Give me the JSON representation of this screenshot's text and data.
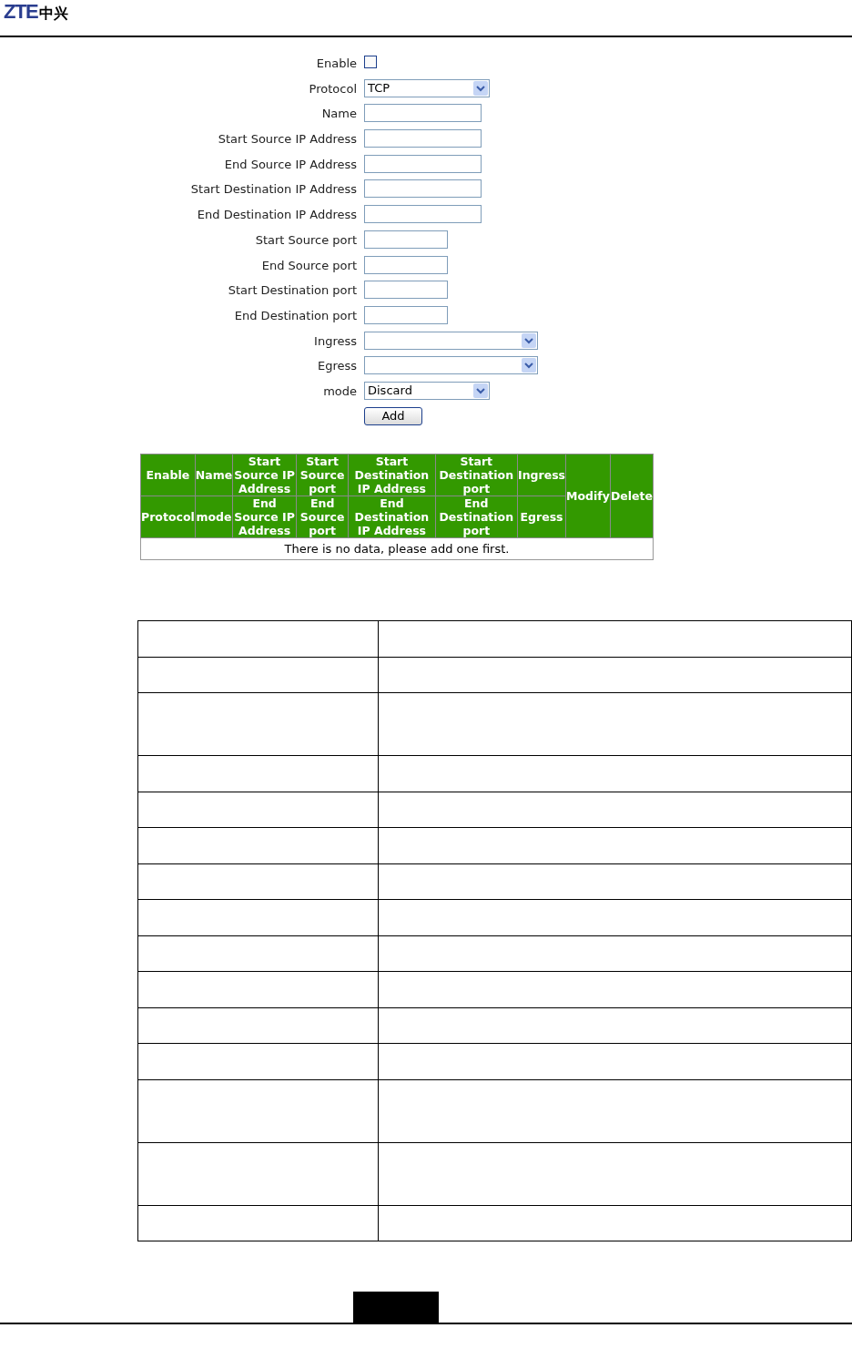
{
  "logo": {
    "latin": "ZTE",
    "cjk": "中兴"
  },
  "form": {
    "fields": [
      {
        "label": "Enable",
        "kind": "checkbox",
        "checked": false
      },
      {
        "label": "Protocol",
        "kind": "select",
        "value": "TCP"
      },
      {
        "label": "Name",
        "kind": "text"
      },
      {
        "label": "Start Source IP Address",
        "kind": "text"
      },
      {
        "label": "End Source IP Address",
        "kind": "text"
      },
      {
        "label": "Start Destination IP Address",
        "kind": "text"
      },
      {
        "label": "End Destination IP Address",
        "kind": "text"
      },
      {
        "label": "Start Source port",
        "kind": "port"
      },
      {
        "label": "End Source port",
        "kind": "port"
      },
      {
        "label": "Start Destination port",
        "kind": "port"
      },
      {
        "label": "End Destination port",
        "kind": "port"
      },
      {
        "label": "Ingress",
        "kind": "wide-select"
      },
      {
        "label": "Egress",
        "kind": "wide-select"
      },
      {
        "label": "mode",
        "kind": "select",
        "value": "Discard"
      }
    ],
    "button": "Add"
  },
  "rules_table": {
    "columns": [
      {
        "top": "Enable",
        "bottom": "Protocol"
      },
      {
        "top": "Name",
        "bottom": "mode"
      },
      {
        "top": "Start Source IP Address",
        "bottom": "End Source IP Address"
      },
      {
        "top": "Start Source port",
        "bottom": "End Source port"
      },
      {
        "top": "Start Destination IP Address",
        "bottom": "End Destination IP Address"
      },
      {
        "top": "Start Destination port",
        "bottom": "End Destination port"
      },
      {
        "top": "Ingress",
        "bottom": "Egress"
      }
    ],
    "spanning": [
      "Modify",
      "Delete"
    ],
    "empty_message": "There is no data, please add one first."
  },
  "doc_table": {
    "rows": [
      {
        "tall": false
      },
      {
        "tall": false
      },
      {
        "tall": true
      },
      {
        "tall": false
      },
      {
        "tall": false
      },
      {
        "tall": false
      },
      {
        "tall": false
      },
      {
        "tall": false
      },
      {
        "tall": false
      },
      {
        "tall": false
      },
      {
        "tall": false
      },
      {
        "tall": false
      },
      {
        "tall": true
      },
      {
        "tall": true
      },
      {
        "tall": false
      }
    ]
  }
}
